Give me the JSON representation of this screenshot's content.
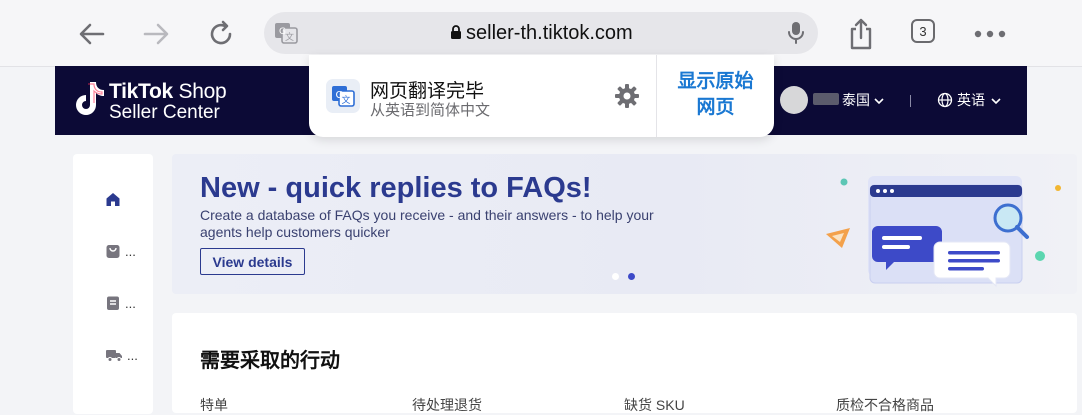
{
  "browser": {
    "url": "seller-th.tiktok.com",
    "tab_count": "3"
  },
  "header": {
    "logo_brand": "TikTok",
    "logo_shop": "Shop",
    "logo_subtitle": "Seller Center",
    "region": "泰国",
    "language": "英语"
  },
  "translate_popup": {
    "title": "网页翻译完毕",
    "subtitle": "从英语到简体中文",
    "show_original_line1": "显示原始",
    "show_original_line2": "网页"
  },
  "sidebar": {
    "items": [
      {
        "icon": "home-icon",
        "label": ""
      },
      {
        "icon": "shopping-bag-icon",
        "label": "..."
      },
      {
        "icon": "document-icon",
        "label": "..."
      },
      {
        "icon": "truck-icon",
        "label": "..."
      }
    ]
  },
  "banner": {
    "title": "New - quick replies to FAQs!",
    "description": "Create a database of FAQs you receive - and their answers - to help your agents help customers quicker",
    "button": "View details",
    "slide_count": 2,
    "active_slide": 2
  },
  "actions": {
    "title": "需要采取的行动",
    "columns": [
      "特单",
      "待处理退货",
      "缺货 SKU",
      "质检不合格商品"
    ]
  },
  "colors": {
    "header_bg": "#0c0a36",
    "accent_blue": "#1a78d2",
    "banner_text": "#2b3a8f"
  }
}
